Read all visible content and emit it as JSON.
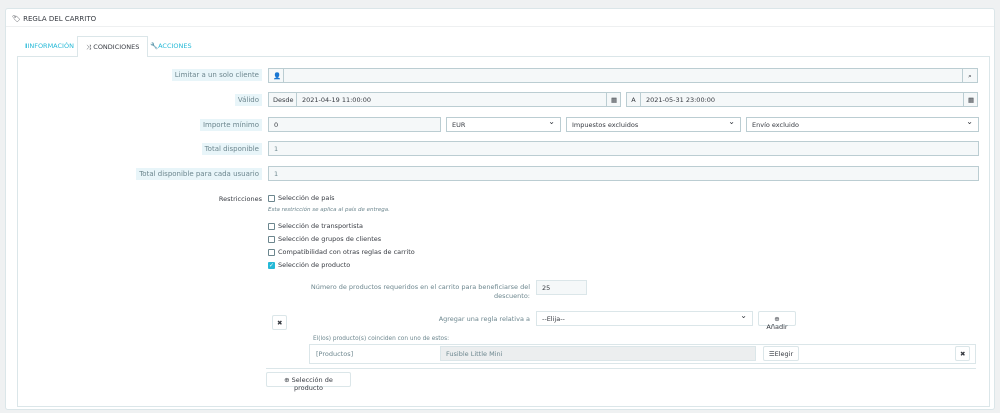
{
  "panel": {
    "title": "REGLA DEL CARRITO"
  },
  "tabs": [
    {
      "label": "INFORMACIÓN"
    },
    {
      "label": "CONDICIONES"
    },
    {
      "label": "ACCIONES"
    }
  ],
  "form": {
    "customer": {
      "label": "Limitar a un solo cliente",
      "value": ""
    },
    "valid": {
      "label": "Válido",
      "from_label": "Desde",
      "from": "2021-04-19 11:00:00",
      "to_label": "A",
      "to": "2021-05-31 23:00:00"
    },
    "minimum": {
      "label": "Importe mínimo",
      "value": "0",
      "currency": "EUR",
      "tax": "Impuestos excluidos",
      "shipping": "Envío excluido"
    },
    "total": {
      "label": "Total disponible",
      "value": "1"
    },
    "per_user": {
      "label": "Total disponible para cada usuario",
      "value": "1"
    },
    "restrictions": {
      "label": "Restricciones",
      "country": "Selección de país",
      "country_hint": "Esta restricción se aplica al país de entrega.",
      "carrier": "Selección de transportista",
      "groups": "Selección de grupos de clientes",
      "compat": "Compatibilidad con otras reglas de carrito",
      "product": "Selección de producto"
    },
    "product_rule": {
      "qty_label": "Número de productos requeridos en el carrito para beneficiarse del descuento:",
      "qty": "25",
      "add_label": "Agregar una regla relativa a",
      "add_select": "--Elija--",
      "add_button": "Añadir",
      "match_label": "El(los) producto(s) coinciden con uno de estos:",
      "type": "[Productos]",
      "value": "Fusible Little Mini",
      "choose_button": "Elegir"
    },
    "add_selection_button": "Selección de producto"
  }
}
